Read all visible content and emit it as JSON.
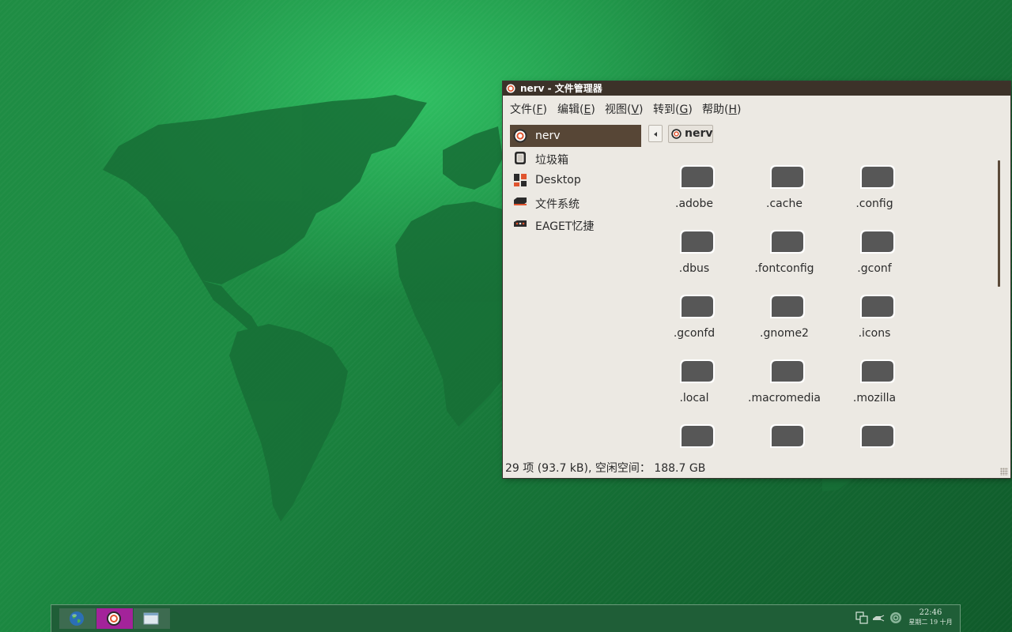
{
  "window": {
    "title": "nerv - 文件管理器"
  },
  "menubar": [
    {
      "label": "文件",
      "accel": "F"
    },
    {
      "label": "编辑",
      "accel": "E"
    },
    {
      "label": "视图",
      "accel": "V"
    },
    {
      "label": "转到",
      "accel": "G"
    },
    {
      "label": "帮助",
      "accel": "H"
    }
  ],
  "sidebar": {
    "items": [
      {
        "label": "nerv",
        "icon": "home-icon",
        "selected": true
      },
      {
        "label": "垃圾箱",
        "icon": "trash-icon",
        "selected": false
      },
      {
        "label": "Desktop",
        "icon": "desktop-icon",
        "selected": false
      },
      {
        "label": "文件系统",
        "icon": "filesystem-icon",
        "selected": false
      },
      {
        "label": "EAGET忆捷",
        "icon": "usb-drive-icon",
        "selected": false
      }
    ]
  },
  "pathbar": {
    "current": "nerv"
  },
  "files": [
    {
      "name": ".adobe"
    },
    {
      "name": ".cache"
    },
    {
      "name": ".config"
    },
    {
      "name": ".dbus"
    },
    {
      "name": ".fontconfig"
    },
    {
      "name": ".gconf"
    },
    {
      "name": ".gconfd"
    },
    {
      "name": ".gnome2"
    },
    {
      "name": ".icons"
    },
    {
      "name": ".local"
    },
    {
      "name": ".macromedia"
    },
    {
      "name": ".mozilla"
    },
    {
      "name": ""
    },
    {
      "name": ""
    },
    {
      "name": ""
    }
  ],
  "status": {
    "text": "29 项 (93.7 kB), 空闲空间：  188.7 GB"
  },
  "taskbar": {
    "buttons": [
      {
        "icon": "globe-icon",
        "active": false
      },
      {
        "icon": "file-manager-icon",
        "active": true
      },
      {
        "icon": "window-icon",
        "active": false
      }
    ],
    "tray": [
      "network-icon",
      "power-icon",
      "disc-icon"
    ],
    "clock": {
      "time": "22:46",
      "date": "星期二 19 十月"
    }
  },
  "colors": {
    "accent": "#574636",
    "titlebar": "#3c3229",
    "window_bg": "#ece9e3",
    "desktop": "#1c8a42",
    "taskbar_active": "#a3239a"
  }
}
